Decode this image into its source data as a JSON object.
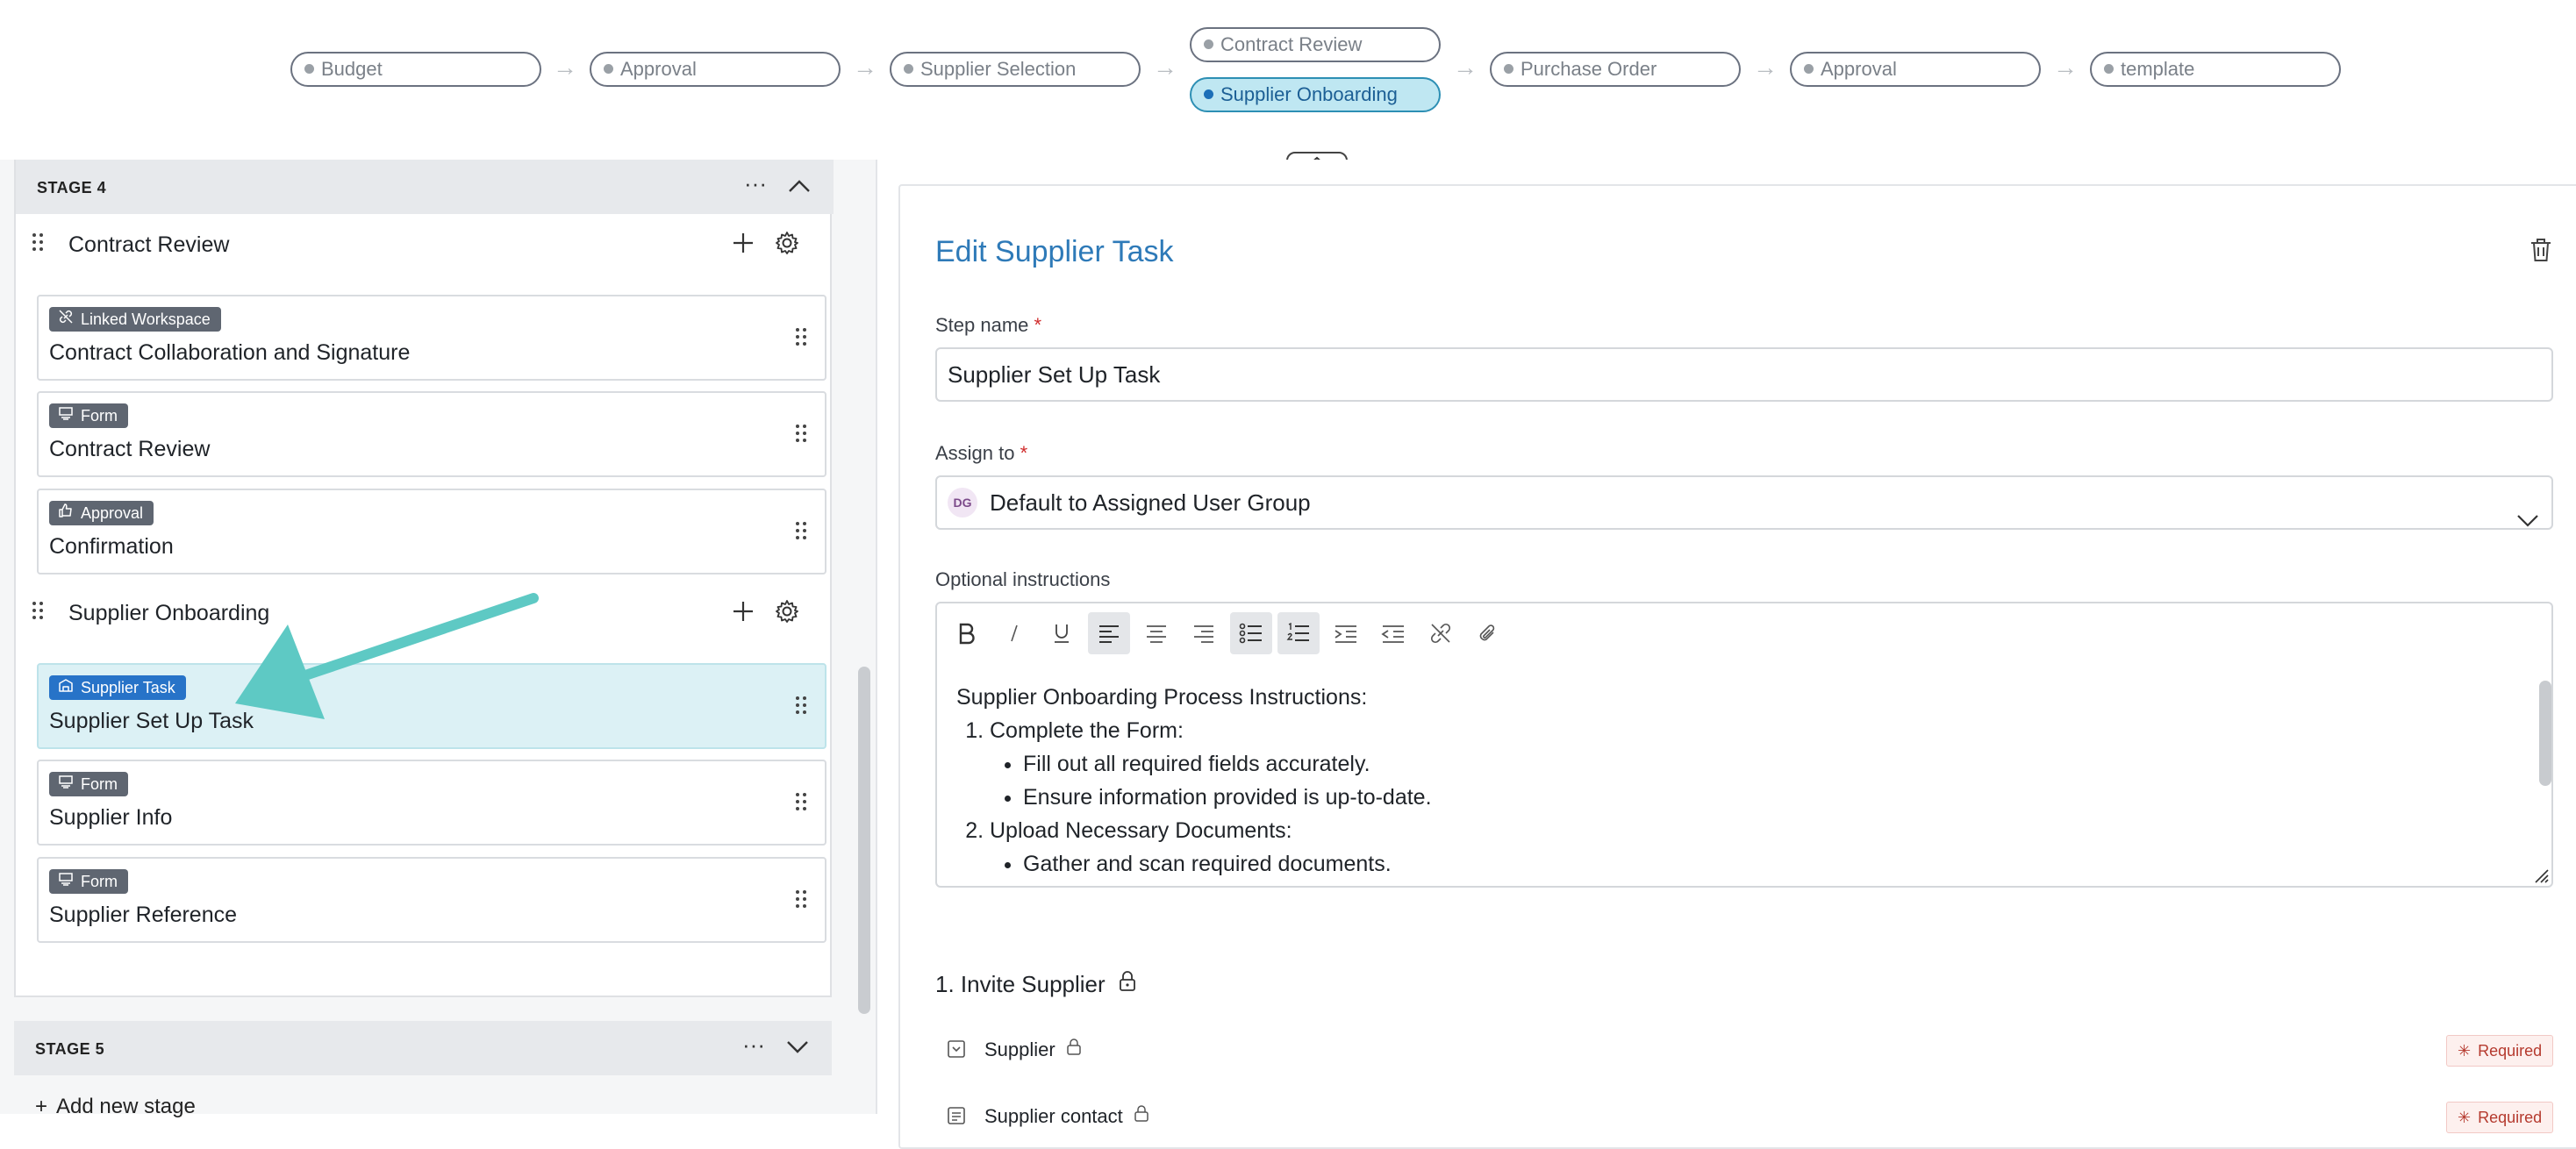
{
  "pipeline": {
    "stages": [
      {
        "label": "Budget"
      },
      {
        "label": "Approval"
      },
      {
        "label": "Supplier Selection"
      },
      {
        "label": "Contract Review"
      },
      {
        "label": "Supplier Onboarding",
        "active": true
      },
      {
        "label": "Purchase Order"
      },
      {
        "label": "Approval"
      },
      {
        "label": "template"
      }
    ]
  },
  "left": {
    "stage4": {
      "label": "STAGE 4",
      "groups": [
        {
          "title": "Contract Review",
          "steps": [
            {
              "badge": "Linked Workspace",
              "badge_icon": "link-off-icon",
              "name": "Contract Collaboration and Signature"
            },
            {
              "badge": "Form",
              "badge_icon": "form-icon",
              "name": "Contract Review"
            },
            {
              "badge": "Approval",
              "badge_icon": "thumbs-up-icon",
              "name": "Confirmation"
            }
          ]
        },
        {
          "title": "Supplier Onboarding",
          "steps": [
            {
              "badge": "Supplier Task",
              "badge_icon": "supplier-task-icon",
              "name": "Supplier Set Up Task",
              "selected": true
            },
            {
              "badge": "Form",
              "badge_icon": "form-icon",
              "name": "Supplier Info"
            },
            {
              "badge": "Form",
              "badge_icon": "form-icon",
              "name": "Supplier Reference"
            }
          ]
        }
      ]
    },
    "stage5": {
      "label": "STAGE 5"
    },
    "add_stage": "Add new stage"
  },
  "right": {
    "title": "Edit Supplier Task",
    "step_name_label": "Step name",
    "step_name_value": "Supplier Set Up Task",
    "assign_label": "Assign to",
    "assign_avatar": "DG",
    "assign_value": "Default to Assigned User Group",
    "instructions_label": "Optional instructions",
    "instructions": {
      "heading": "Supplier Onboarding Process Instructions:",
      "item1": "Complete the Form:",
      "item1_bullets": [
        "Fill out all required fields accurately.",
        "Ensure information provided is up-to-date."
      ],
      "item2": "Upload Necessary Documents:",
      "item2_bullets": [
        "Gather and scan required documents."
      ]
    },
    "section_title": "1. Invite Supplier",
    "fields": [
      {
        "name": "Supplier",
        "required": "Required"
      },
      {
        "name": "Supplier contact",
        "required": "Required"
      }
    ]
  },
  "colors": {
    "accent": "#2e7ab8",
    "selected_step_bg": "#dcf1f5",
    "annotation_arrow": "#5ec9c4",
    "required": "#b53a2e"
  }
}
